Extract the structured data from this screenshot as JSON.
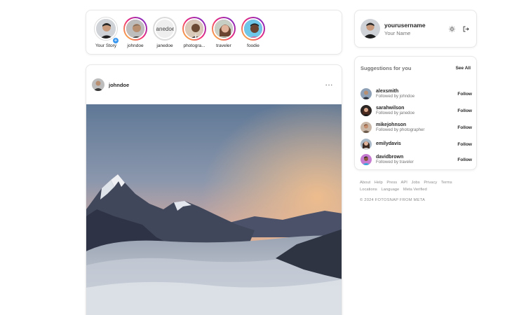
{
  "stories": [
    {
      "label": "Your Story",
      "own": true
    },
    {
      "label": "johndoe"
    },
    {
      "label": "janedoe",
      "avatar_text": "janedoe"
    },
    {
      "label": "photogra..."
    },
    {
      "label": "traveler"
    },
    {
      "label": "foodie"
    }
  ],
  "post": {
    "username": "johndoe",
    "more_label": "···"
  },
  "profile": {
    "username": "yourusername",
    "name": "Your Name"
  },
  "suggestions": {
    "title": "Suggestions for you",
    "see_all": "See All",
    "follow_label": "Follow",
    "items": [
      {
        "username": "alexsmith",
        "sub": "Followed by johndoe"
      },
      {
        "username": "sarahwilson",
        "sub": "Followed by janedoe"
      },
      {
        "username": "mikejohnson",
        "sub": "Followed by photographer"
      },
      {
        "username": "emilydavis",
        "sub": ""
      },
      {
        "username": "davidbrown",
        "sub": "Followed by traveler"
      }
    ]
  },
  "footer": {
    "links": [
      "About",
      "Help",
      "Press",
      "API",
      "Jobs",
      "Privacy",
      "Terms",
      "Locations",
      "Language",
      "Meta Verified"
    ],
    "copyright": "© 2024 FOTOSNAP FROM META"
  },
  "colors": {
    "accent": "#3897f0",
    "muted": "#737373",
    "border": "#e8e8e8"
  }
}
